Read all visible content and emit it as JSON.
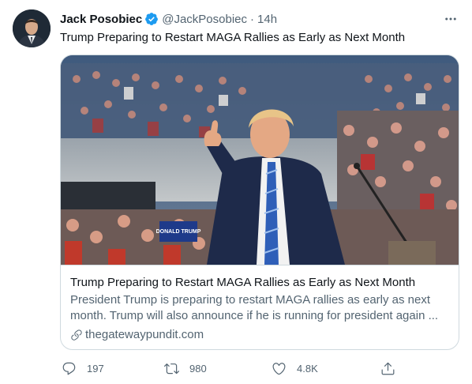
{
  "author": {
    "name": "Jack Posobiec",
    "handle": "@JackPosobiec",
    "separator": "·",
    "time": "14h",
    "verified": true
  },
  "tweet": {
    "text": "Trump Preparing to Restart MAGA Rallies as Early as Next Month"
  },
  "card": {
    "image_icon": "rally-photo",
    "title": "Trump Preparing to Restart MAGA Rallies as Early as Next Month",
    "description": "President Trump is preparing to restart MAGA rallies as early as next month. Trump will also announce if he is running for president again ...",
    "domain": "thegatewaypundit.com",
    "sign_text": "DONALD TRUMP"
  },
  "actions": {
    "replies": "197",
    "retweets": "980",
    "likes": "4.8K"
  },
  "colors": {
    "text": "#0f1419",
    "secondary": "#536471",
    "verified_blue": "#1d9bf0",
    "border": "#cfd9de"
  },
  "icons": {
    "verified": "verified-badge-icon",
    "more": "more-dots-icon",
    "link": "link-icon",
    "reply": "reply-icon",
    "retweet": "retweet-icon",
    "like": "heart-icon",
    "share": "share-icon"
  }
}
